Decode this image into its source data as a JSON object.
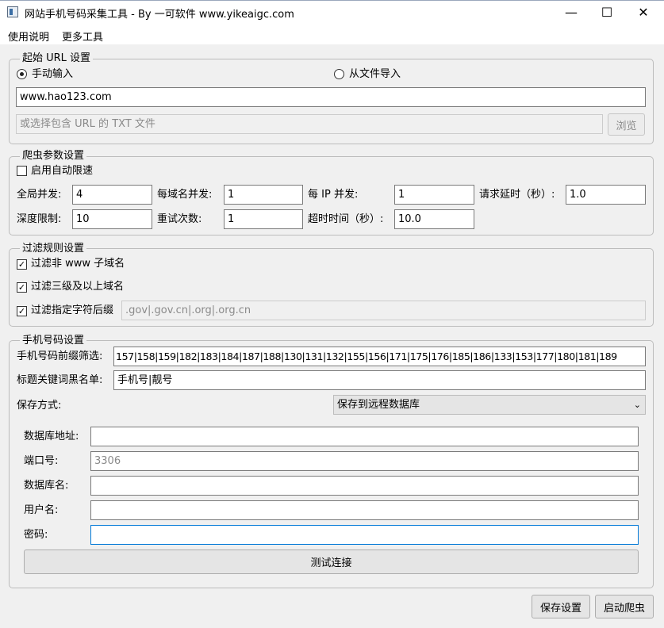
{
  "window": {
    "title": "网站手机号码采集工具 - By 一可软件 www.yikeaigc.com",
    "minimize_glyph": "—",
    "maximize_glyph": "☐",
    "close_glyph": "✕"
  },
  "menu": [
    "使用说明",
    "更多工具"
  ],
  "url_group": {
    "title": "起始 URL 设置",
    "radio_manual": "手动输入",
    "radio_file": "从文件导入",
    "radio_selected": "manual",
    "url_value": "www.hao123.com",
    "file_placeholder": "或选择包含 URL 的 TXT 文件",
    "browse_label": "浏览"
  },
  "crawler_group": {
    "title": "爬虫参数设置",
    "auto_throttle_label": "启用自动限速",
    "auto_throttle_checked": false,
    "global_concurrency_label": "全局并发:",
    "global_concurrency": "4",
    "per_domain_label": "每域名并发:",
    "per_domain": "1",
    "per_ip_label": "每 IP 并发:",
    "per_ip": "1",
    "delay_label": "请求延时（秒）:",
    "delay": "1.0",
    "depth_label": "深度限制:",
    "depth": "10",
    "retry_label": "重试次数:",
    "retry": "1",
    "timeout_label": "超时时间（秒）:",
    "timeout": "10.0"
  },
  "filter_group": {
    "title": "过滤规则设置",
    "filter_non_www": "过滤非 www 子域名",
    "filter_third_level": "过滤三级及以上域名",
    "filter_suffix": "过滤指定字符后缀",
    "suffix_value": ".gov|.gov.cn|.org|.org.cn",
    "checked": [
      true,
      true,
      true
    ]
  },
  "phone_group": {
    "title": "手机号码设置",
    "prefix_label": "手机号码前缀筛选:",
    "prefix_value": "157|158|159|182|183|184|187|188|130|131|132|155|156|171|175|176|185|186|133|153|177|180|181|189",
    "blacklist_label": "标题关键词黑名单:",
    "blacklist_value": "手机号|靓号",
    "save_mode_label": "保存方式:",
    "save_mode_value": "保存到远程数据库",
    "db_address_label": "数据库地址:",
    "db_address": "",
    "port_label": "端口号:",
    "port_placeholder": "3306",
    "db_name_label": "数据库名:",
    "db_name": "",
    "username_label": "用户名:",
    "username": "",
    "password_label": "密码:",
    "password": "",
    "test_button": "测试连接"
  },
  "footer": {
    "save_settings": "保存设置",
    "start_crawler": "启动爬虫"
  }
}
